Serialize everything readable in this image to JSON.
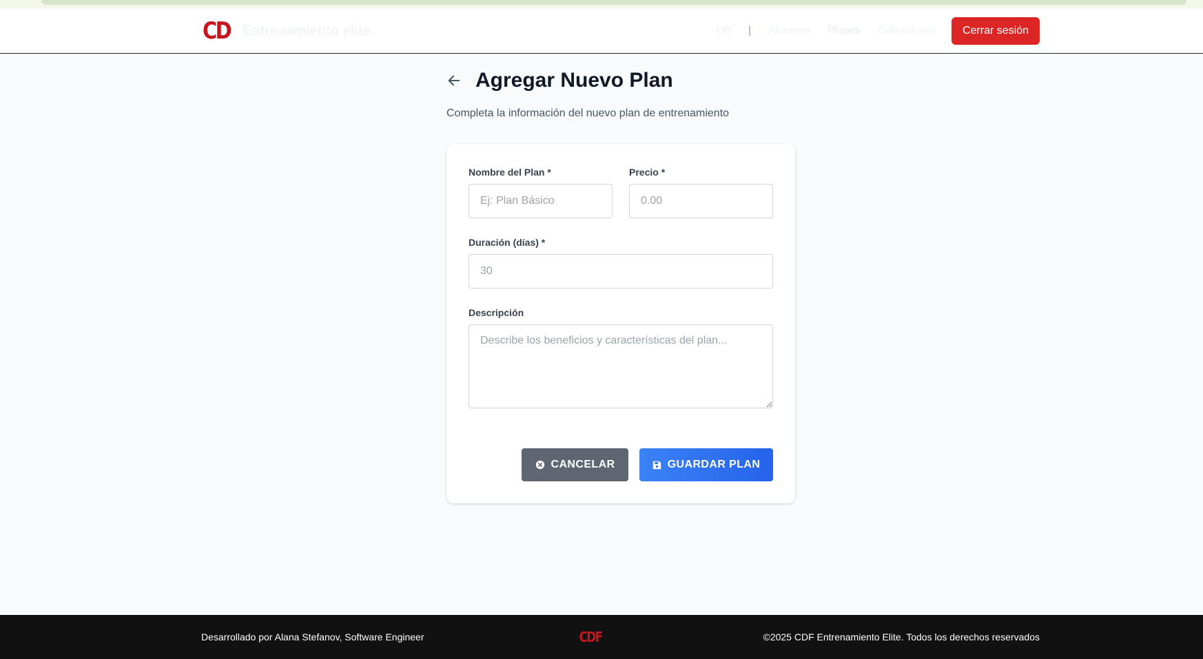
{
  "header": {
    "logo_text": "CD",
    "brand": "Entrenamiento elite.",
    "nav": {
      "user": "DB",
      "separator": "|",
      "items": [
        "Alumnos",
        "Planes",
        "Cobradores"
      ],
      "logout": "Cerrar sesión"
    }
  },
  "page": {
    "title": "Agregar Nuevo Plan",
    "subtitle": "Completa la información del nuevo plan de entrenamiento"
  },
  "form": {
    "name": {
      "label": "Nombre del Plan *",
      "placeholder": "Ej: Plan Básico",
      "value": ""
    },
    "price": {
      "label": "Precio *",
      "placeholder": "0.00",
      "value": ""
    },
    "duration": {
      "label": "Duración (días) *",
      "placeholder": "30",
      "value": ""
    },
    "description": {
      "label": "Descripción",
      "placeholder": "Describe los beneficios y características del plan...",
      "value": ""
    },
    "cancel_label": "CANCELAR",
    "save_label": "GUARDAR PLAN"
  },
  "footer": {
    "left": "Desarrollado por Alana Stefanov, Software Engineer",
    "logo_text": "CDF",
    "right": "©2025 CDF Entrenamiento Elite. Todos los derechos reservados"
  },
  "colors": {
    "primary": "#2563eb",
    "danger": "#dc2626",
    "cancel": "#5f6672",
    "brand_red": "#c4161c"
  },
  "icons": {
    "back": "arrow-left-icon",
    "cancel": "x-circle-icon",
    "save": "save-icon"
  }
}
